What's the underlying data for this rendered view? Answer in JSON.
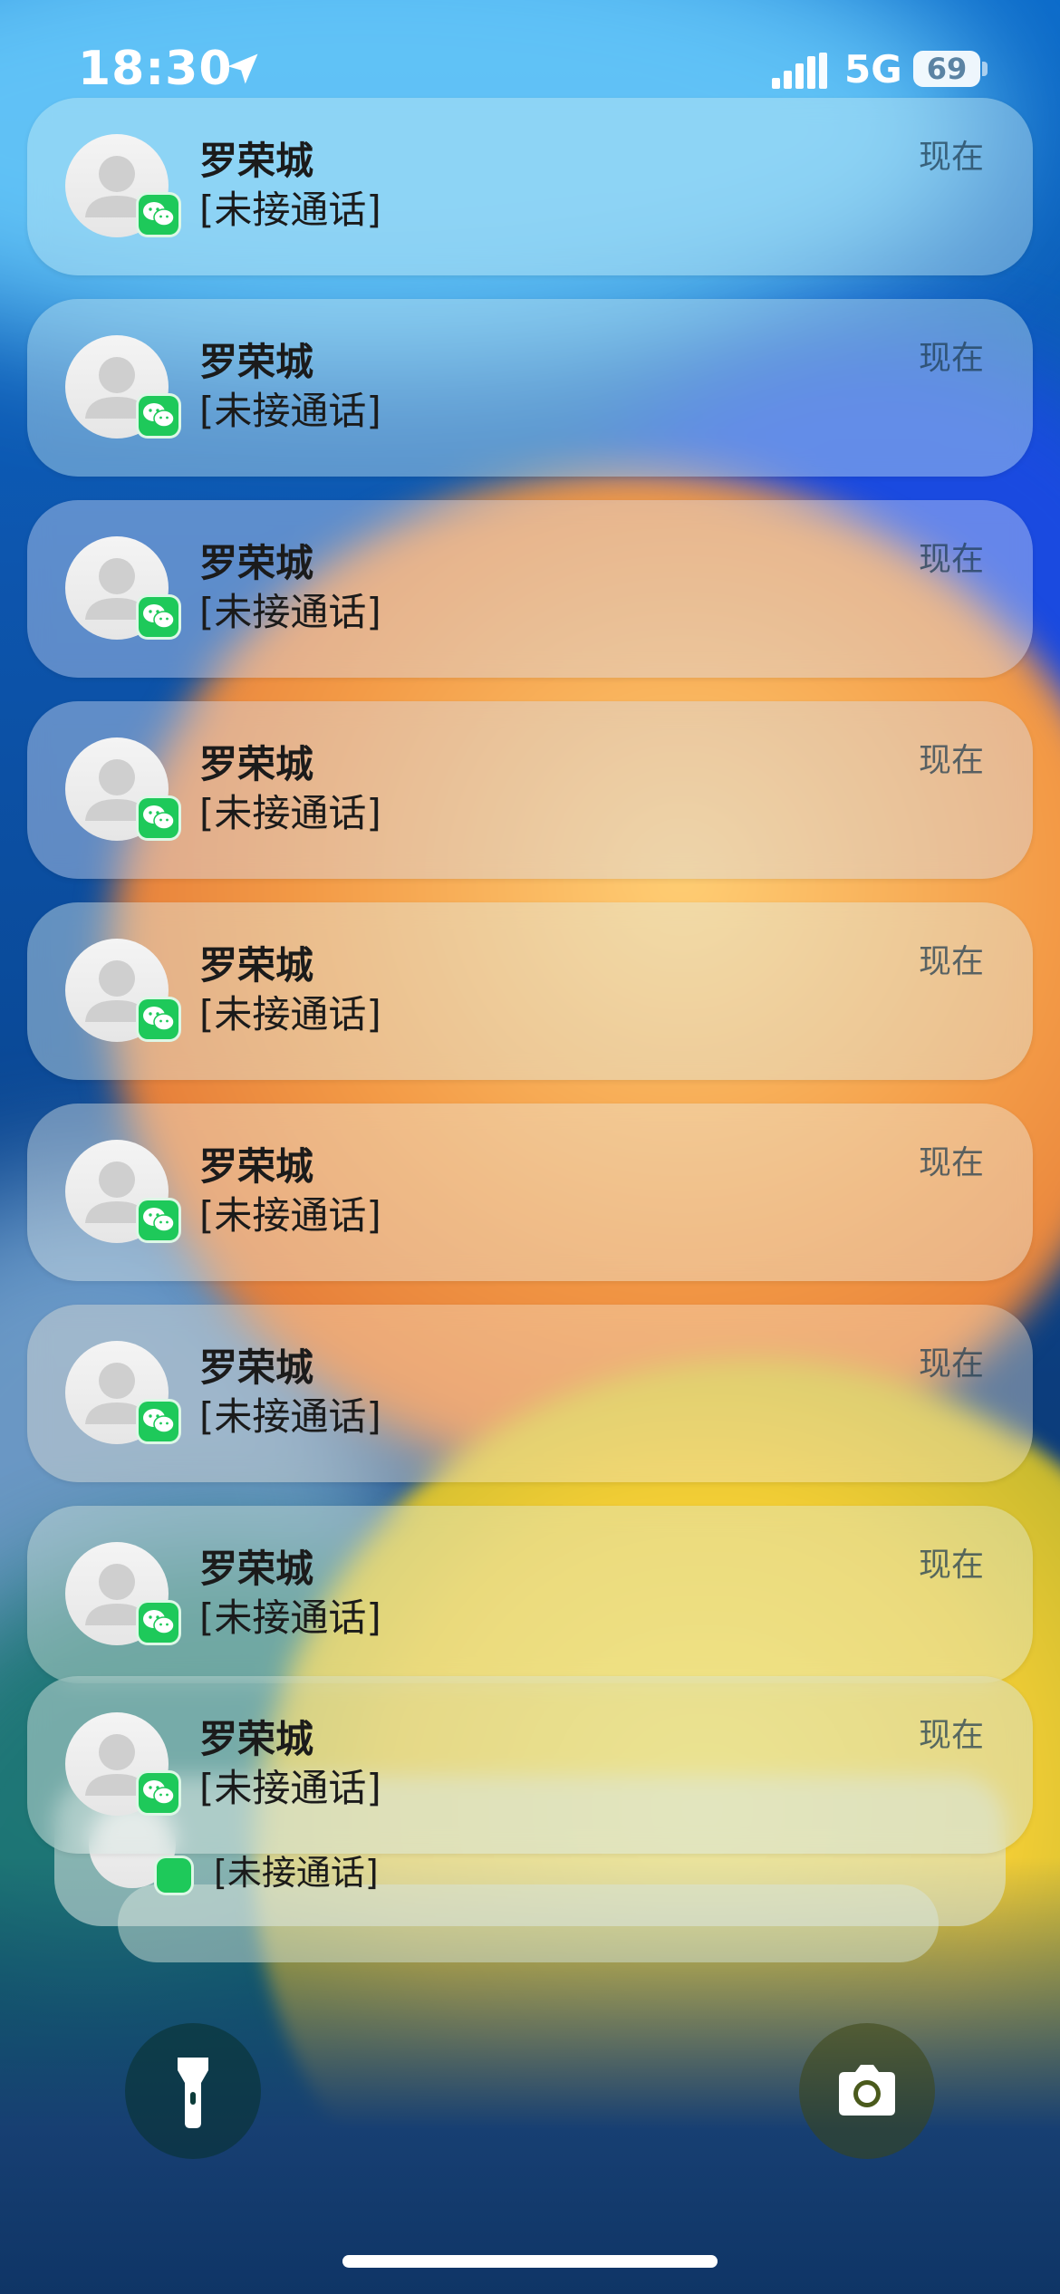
{
  "status_bar": {
    "time": "18:30",
    "network": "5G",
    "battery": "69"
  },
  "notifications": [
    {
      "title": "罗荣城",
      "body": "[未接通话]",
      "time": "现在"
    },
    {
      "title": "罗荣城",
      "body": "[未接通话]",
      "time": "现在"
    },
    {
      "title": "罗荣城",
      "body": "[未接通话]",
      "time": "现在"
    },
    {
      "title": "罗荣城",
      "body": "[未接通话]",
      "time": "现在"
    },
    {
      "title": "罗荣城",
      "body": "[未接通话]",
      "time": "现在"
    },
    {
      "title": "罗荣城",
      "body": "[未接通话]",
      "time": "现在"
    },
    {
      "title": "罗荣城",
      "body": "[未接通话]",
      "time": "现在"
    },
    {
      "title": "罗荣城",
      "body": "[未接通话]",
      "time": "现在"
    },
    {
      "title": "罗荣城",
      "body": "[未接通话]",
      "time": "现在"
    }
  ],
  "stack_peek": {
    "body": "[未接通话]"
  },
  "app_badge_icon": "wechat-icon",
  "lockscreen_controls": {
    "left": "flashlight-icon",
    "right": "camera-icon"
  }
}
